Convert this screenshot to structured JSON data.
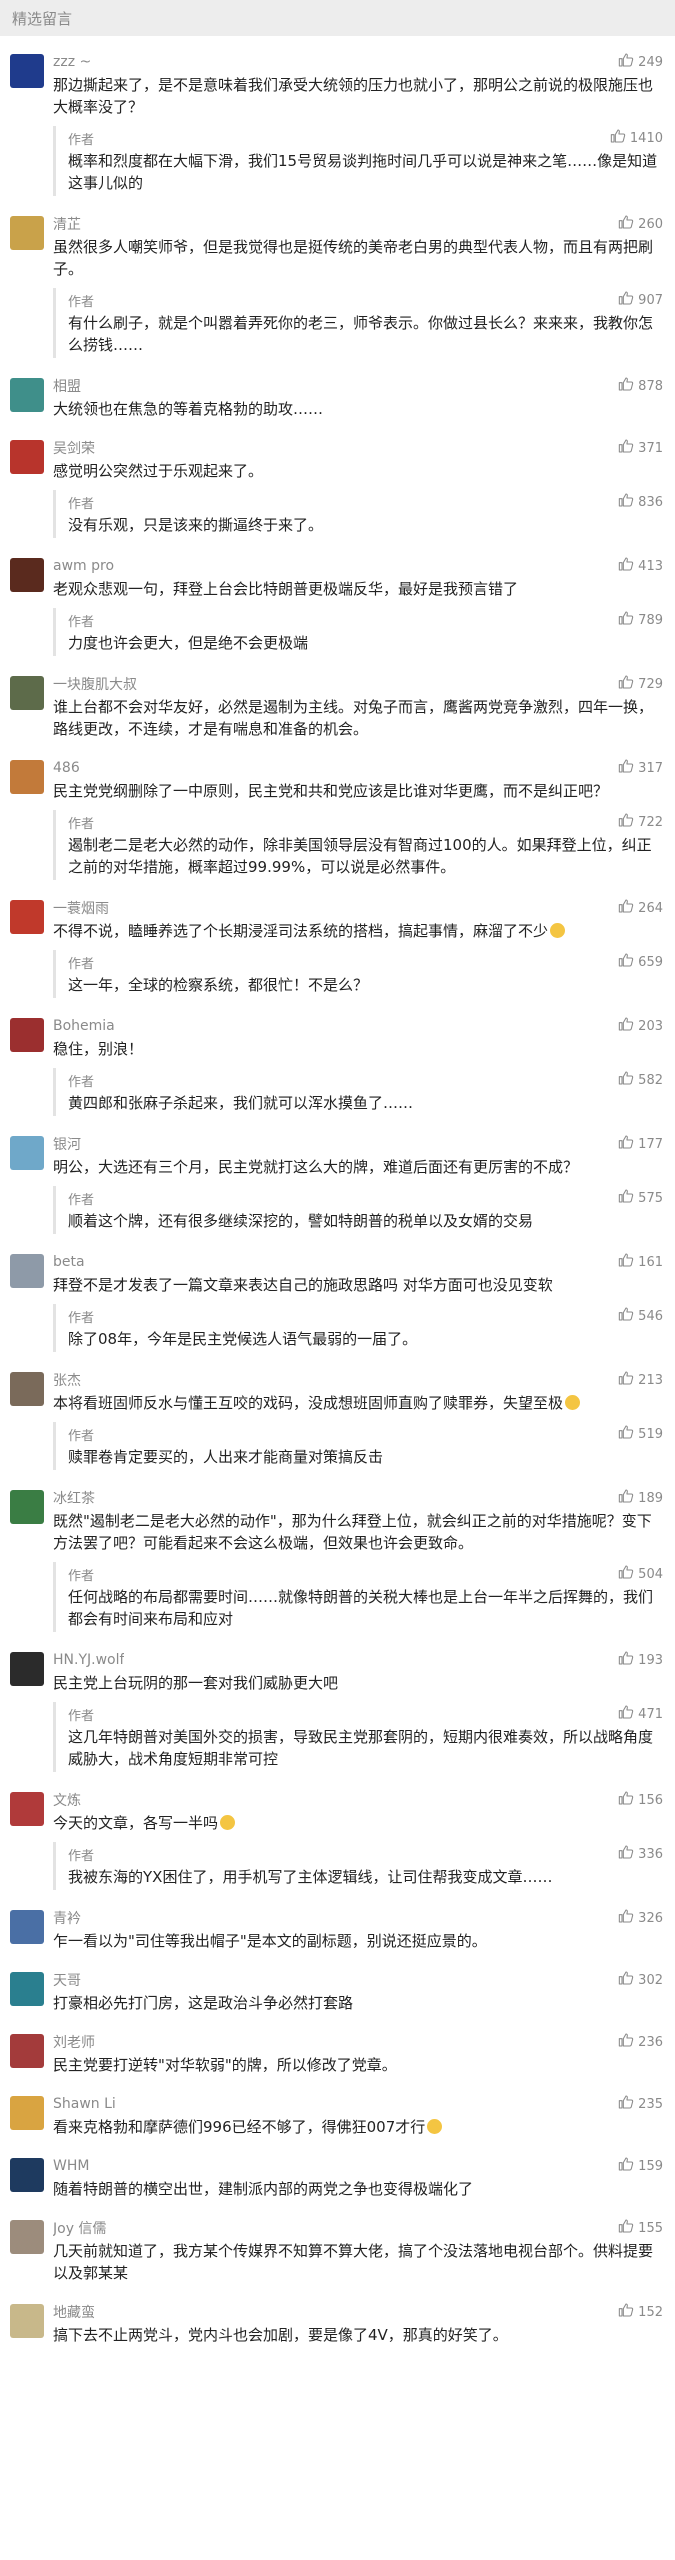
{
  "header": {
    "title": "精选留言"
  },
  "reply_author_label": "作者",
  "comments": [
    {
      "nick": "zzz ~",
      "avatar_color": "#1f3b8c",
      "likes": "249",
      "text": "那边撕起来了，是不是意味着我们承受大统领的压力也就小了，那明公之前说的极限施压也大概率没了？",
      "reply": {
        "text": "概率和烈度都在大幅下滑，我们15号贸易谈判拖时间几乎可以说是神来之笔……像是知道这事儿似的",
        "likes": "1410"
      }
    },
    {
      "nick": "清芷",
      "avatar_color": "#c9a24a",
      "likes": "260",
      "text": "虽然很多人嘲笑师爷，但是我觉得也是挺传统的美帝老白男的典型代表人物，而且有两把刷子。",
      "reply": {
        "text": "有什么刷子，就是个叫嚣着弄死你的老三，师爷表示。你做过县长么？来来来，我教你怎么捞钱……",
        "likes": "907"
      }
    },
    {
      "nick": "相盟",
      "avatar_color": "#3f8f8a",
      "likes": "878",
      "text": "大统领也在焦急的等着克格勃的助攻……"
    },
    {
      "nick": "吴剑荣",
      "avatar_color": "#b8342c",
      "likes": "371",
      "text": "感觉明公突然过于乐观起来了。",
      "reply": {
        "text": "没有乐观，只是该来的撕逼终于来了。",
        "likes": "836"
      }
    },
    {
      "nick": "awm pro",
      "avatar_color": "#5a2a1e",
      "likes": "413",
      "text": "老观众悲观一句，拜登上台会比特朗普更极端反华，最好是我预言错了",
      "reply": {
        "text": "力度也许会更大，但是绝不会更极端",
        "likes": "789"
      }
    },
    {
      "nick": "一块腹肌大叔",
      "avatar_color": "#5d6b4a",
      "likes": "729",
      "text": "谁上台都不会对华友好，必然是遏制为主线。对兔子而言，鹰酱两党竞争激烈，四年一换，路线更改，不连续，才是有喘息和准备的机会。"
    },
    {
      "nick": "486",
      "avatar_color": "#c27a3a",
      "likes": "317",
      "text": "民主党党纲删除了一中原则，民主党和共和党应该是比谁对华更鹰，而不是纠正吧？",
      "reply": {
        "text": "遏制老二是老大必然的动作，除非美国领导层没有智商过100的人。如果拜登上位，纠正之前的对华措施，概率超过99.99%，可以说是必然事件。",
        "likes": "722"
      }
    },
    {
      "nick": "一蓑烟雨",
      "avatar_color": "#c0392b",
      "likes": "264",
      "text": "不得不说，瞌睡养选了个长期浸淫司法系统的搭档，搞起事情，麻溜了不少",
      "emoji": true,
      "reply": {
        "text": "这一年，全球的检察系统，都很忙！不是么？",
        "likes": "659"
      }
    },
    {
      "nick": "Bohemia",
      "avatar_color": "#9b2f2f",
      "likes": "203",
      "text": "稳住，别浪！",
      "reply": {
        "text": "黄四郎和张麻子杀起来，我们就可以浑水摸鱼了……",
        "likes": "582"
      }
    },
    {
      "nick": "银河",
      "avatar_color": "#6fa8c9",
      "likes": "177",
      "text": "明公，大选还有三个月，民主党就打这么大的牌，难道后面还有更厉害的不成？",
      "reply": {
        "text": "顺着这个牌，还有很多继续深挖的，譬如特朗普的税单以及女婿的交易",
        "likes": "575"
      }
    },
    {
      "nick": "beta",
      "avatar_color": "#8e9aa8",
      "likes": "161",
      "text": "拜登不是才发表了一篇文章来表达自己的施政思路吗 对华方面可也没见变软",
      "reply": {
        "text": "除了08年，今年是民主党候选人语气最弱的一届了。",
        "likes": "546"
      }
    },
    {
      "nick": "张杰",
      "avatar_color": "#7a6a5a",
      "likes": "213",
      "text": "本将看班固师反水与懂王互咬的戏码，没成想班固师直购了赎罪券，失望至极",
      "emoji": true,
      "reply": {
        "text": "赎罪卷肯定要买的，人出来才能商量对策搞反击",
        "likes": "519"
      }
    },
    {
      "nick": "冰红茶",
      "avatar_color": "#3a7d44",
      "likes": "189",
      "text": "既然\"遏制老二是老大必然的动作\"，那为什么拜登上位，就会纠正之前的对华措施呢？变下方法罢了吧？可能看起来不会这么极端，但效果也许会更致命。",
      "reply": {
        "text": "任何战略的布局都需要时间……就像特朗普的关税大棒也是上台一年半之后挥舞的，我们都会有时间来布局和应对",
        "likes": "504"
      }
    },
    {
      "nick": "HN.YJ.wolf",
      "avatar_color": "#2b2b2b",
      "likes": "193",
      "text": "民主党上台玩阴的那一套对我们威胁更大吧",
      "reply": {
        "text": "这几年特朗普对美国外交的损害，导致民主党那套阴的，短期内很难奏效，所以战略角度威胁大，战术角度短期非常可控",
        "likes": "471"
      }
    },
    {
      "nick": "文炼",
      "avatar_color": "#b03a3a",
      "likes": "156",
      "text": "今天的文章，各写一半吗",
      "emoji": true,
      "reply": {
        "text": "我被东海的YX困住了，用手机写了主体逻辑线，让司住帮我变成文章……",
        "likes": "336"
      }
    },
    {
      "nick": "青衿",
      "avatar_color": "#4a6fa5",
      "likes": "326",
      "text": "乍一看以为\"司住等我出帽子\"是本文的副标题，别说还挺应景的。"
    },
    {
      "nick": "天哥",
      "avatar_color": "#2a7f8f",
      "likes": "302",
      "text": "打豪相必先打门房，这是政治斗争必然打套路"
    },
    {
      "nick": "刘老师",
      "avatar_color": "#a33b3b",
      "likes": "236",
      "text": "民主党要打逆转\"对华软弱\"的牌，所以修改了党章。"
    },
    {
      "nick": "Shawn Li",
      "avatar_color": "#d9a441",
      "likes": "235",
      "text": "看来克格勃和摩萨德们996已经不够了，得佛狂007才行",
      "emoji": true
    },
    {
      "nick": "WHM",
      "avatar_color": "#1e3a5f",
      "likes": "159",
      "text": "随着特朗普的横空出世，建制派内部的两党之争也变得极端化了"
    },
    {
      "nick": "Joy 信儒",
      "avatar_color": "#9c8c7c",
      "likes": "155",
      "text": "几天前就知道了，我方某个传媒界不知算不算大佬，搞了个没法落地电视台部个。供料提要以及郭某某"
    },
    {
      "nick": "地藏蛮",
      "avatar_color": "#c8b88a",
      "likes": "152",
      "text": "搞下去不止两党斗，党内斗也会加剧，要是像了4V，那真的好笑了。"
    }
  ]
}
